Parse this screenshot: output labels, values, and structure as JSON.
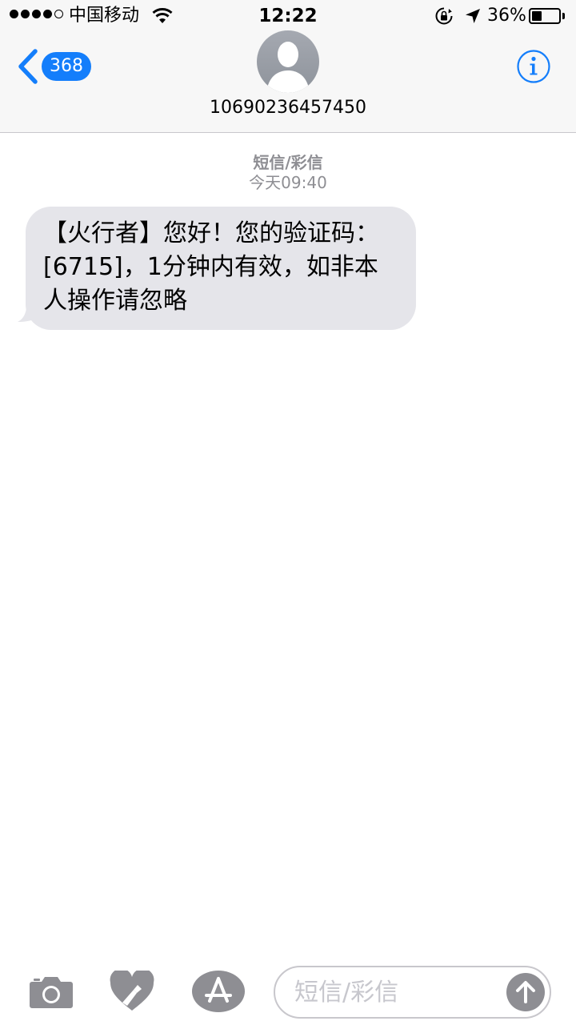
{
  "status_bar": {
    "carrier": "中国移动",
    "time": "12:22",
    "battery_percent_label": "36%",
    "battery_level": 0.36,
    "signal_bars_filled": 4,
    "signal_bars_total": 5
  },
  "nav": {
    "back_badge": "368",
    "contact_name": "10690236457450",
    "icons": {
      "back": "chevron-left-icon",
      "avatar": "person-silhouette-icon",
      "info": "info-icon"
    }
  },
  "conversation": {
    "message_type": "短信/彩信",
    "timestamp": "今天09:40",
    "messages": [
      {
        "direction": "incoming",
        "text": "【火行者】您好！您的验证码：[6715]，1分钟内有效，如非本人操作请忽略"
      }
    ]
  },
  "input_bar": {
    "placeholder": "短信/彩信",
    "icons": {
      "camera": "camera-icon",
      "digital_touch": "digital-touch-heart-icon",
      "app_store": "app-store-icon",
      "send": "send-arrow-up-icon"
    }
  },
  "colors": {
    "accent": "#147efb",
    "incoming_bubble": "#e5e5ea",
    "secondary_text": "#8e8e93",
    "header_bg": "#f7f7f7"
  }
}
